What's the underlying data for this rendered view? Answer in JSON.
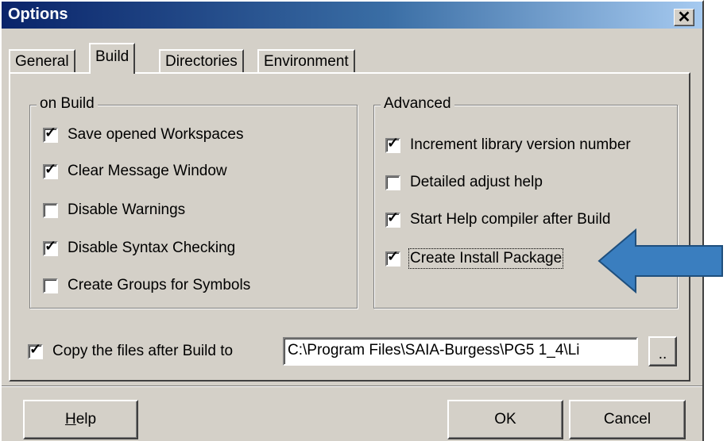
{
  "window": {
    "title": "Options",
    "close_glyph": "✕"
  },
  "tabs": [
    {
      "label": "General",
      "active": false
    },
    {
      "label": "Build",
      "active": true
    },
    {
      "label": "Directories",
      "active": false
    },
    {
      "label": "Environment",
      "active": false
    }
  ],
  "on_build": {
    "label": "on Build",
    "items": [
      {
        "label": "Save opened Workspaces",
        "checked": true
      },
      {
        "label": "Clear Message Window",
        "checked": true
      },
      {
        "label": "Disable Warnings",
        "checked": false
      },
      {
        "label": "Disable Syntax Checking",
        "checked": true
      },
      {
        "label": "Create Groups for Symbols",
        "checked": false
      }
    ]
  },
  "advanced": {
    "label": "Advanced",
    "items": [
      {
        "label": "Increment library version number",
        "checked": true
      },
      {
        "label": "Detailed adjust help",
        "checked": false
      },
      {
        "label": "Start Help compiler after Build",
        "checked": true
      },
      {
        "label": "Create Install Package",
        "checked": true
      }
    ]
  },
  "copy": {
    "label": "Copy the files after Build to",
    "checked": true,
    "path": "C:\\Program Files\\SAIA-Burgess\\PG5 1_4\\Li",
    "browse_label": ".."
  },
  "buttons": {
    "help": "Help",
    "ok": "OK",
    "cancel": "Cancel"
  },
  "check_glyph": "✓",
  "annotation": {
    "arrow_color": "#3a7ebf",
    "arrow_stroke": "#1f4f7d"
  }
}
